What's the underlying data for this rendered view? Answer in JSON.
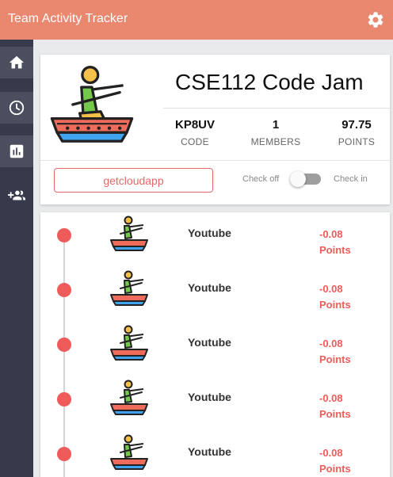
{
  "app": {
    "title": "Team Activity Tracker"
  },
  "sidebar": {
    "items": [
      {
        "name": "home",
        "icon": "home-icon"
      },
      {
        "name": "history",
        "icon": "clock-icon"
      },
      {
        "name": "stats",
        "icon": "bar-chart-icon"
      },
      {
        "name": "members",
        "icon": "group-add-icon"
      }
    ]
  },
  "team": {
    "name": "CSE112 Code Jam",
    "stats": [
      {
        "value": "KP8UV",
        "label": "CODE"
      },
      {
        "value": "1",
        "label": "MEMBERS"
      },
      {
        "value": "97.75",
        "label": "POINTS"
      }
    ],
    "app_name": "getcloudapp",
    "toggle": {
      "off_label": "Check off",
      "on_label": "Check in",
      "checked": false
    }
  },
  "activity": [
    {
      "site": "Youtube",
      "points": "-0.08",
      "unit": "Points"
    },
    {
      "site": "Youtube",
      "points": "-0.08",
      "unit": "Points"
    },
    {
      "site": "Youtube",
      "points": "-0.08",
      "unit": "Points"
    },
    {
      "site": "Youtube",
      "points": "-0.08",
      "unit": "Points"
    },
    {
      "site": "Youtube",
      "points": "-0.08",
      "unit": "Points"
    }
  ],
  "colors": {
    "header": "#e9876f",
    "sidebar": "#363a4b",
    "accent": "#ef5b5b"
  }
}
